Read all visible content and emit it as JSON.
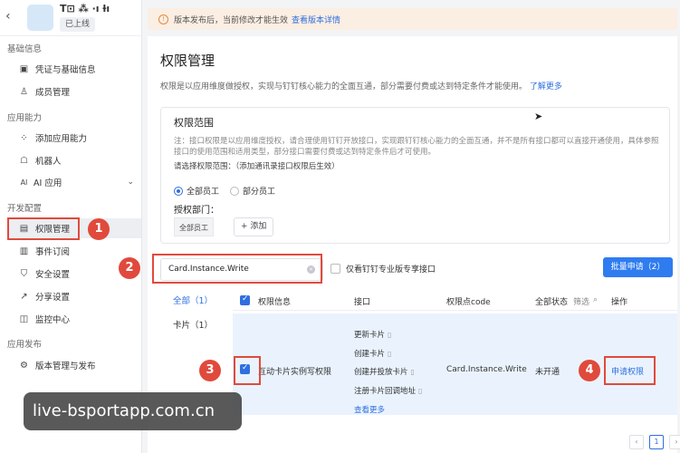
{
  "app": {
    "back_icon": "‹",
    "name": "T⊡ ⁂ ·ı ƚı",
    "status": "已上线"
  },
  "sidebar": {
    "sections": [
      {
        "title": "基础信息",
        "items": [
          {
            "label": "凭证与基础信息",
            "icon": "credential-icon"
          },
          {
            "label": "成员管理",
            "icon": "member-icon"
          }
        ]
      },
      {
        "title": "应用能力",
        "items": [
          {
            "label": "添加应用能力",
            "icon": "apps-icon"
          },
          {
            "label": "机器人",
            "icon": "robot-icon"
          },
          {
            "label": "AI 应用",
            "icon": "ai-icon"
          }
        ]
      },
      {
        "title": "开发配置",
        "items": [
          {
            "label": "权限管理",
            "icon": "permission-icon"
          },
          {
            "label": "事件订阅",
            "icon": "event-icon"
          },
          {
            "label": "安全设置",
            "icon": "security-icon"
          },
          {
            "label": "分享设置",
            "icon": "share-icon"
          },
          {
            "label": "监控中心",
            "icon": "monitor-icon"
          }
        ]
      },
      {
        "title": "应用发布",
        "items": [
          {
            "label": "版本管理与发布",
            "icon": "version-icon"
          }
        ]
      }
    ]
  },
  "notice": {
    "text": "版本发布后，当前修改才能生效",
    "link": "查看版本详情"
  },
  "page": {
    "title": "权限管理",
    "desc": "权限是以应用维度做授权，实现与钉钉核心能力的全面互通，部分需要付费或达到特定条件才能使用。",
    "desc_link": "了解更多"
  },
  "scope": {
    "title": "权限范围",
    "note": "注：接口权限是以应用维度授权，请合理使用钉钉开放接口，实现跟钉钉核心能力的全面互通，并不是所有接口都可以直接开通使用，具体参照接口的使用范围和适用类型，部分接口需要付费或达到特定条件后才可使用。",
    "sub": "请选择权限范围：（添加通讯录接口权限后生效）",
    "radio_all": "全部员工",
    "radio_part": "部分员工",
    "dept_label": "授权部门：",
    "dept_tag": "全部员工",
    "add": "+ 添加"
  },
  "search": {
    "value": "Card.Instance.Write",
    "clear_icon": "×"
  },
  "exclusive_label": "仅看钉钉专业版专享接口",
  "batch_button": "批量申请（2）",
  "categories": [
    {
      "label": "全部（1）"
    },
    {
      "label": "卡片（1）"
    }
  ],
  "table": {
    "headers": {
      "info": "权限信息",
      "api": "接口",
      "code": "权限点code",
      "status": "全部状态",
      "filter": "筛选",
      "op": "操作"
    },
    "row": {
      "name": "互动卡片实例写权限",
      "apis": [
        "更新卡片",
        "创建卡片",
        "创建并投放卡片",
        "注册卡片回调地址"
      ],
      "more": "查看更多",
      "code": "Card.Instance.Write",
      "status": "未开通",
      "action": "申请权限"
    }
  },
  "pager": {
    "prev": "‹",
    "page": "1",
    "next": "›"
  },
  "annotations": [
    "1",
    "2",
    "3",
    "4"
  ],
  "watermark": "live-bsportapp.com.cn"
}
